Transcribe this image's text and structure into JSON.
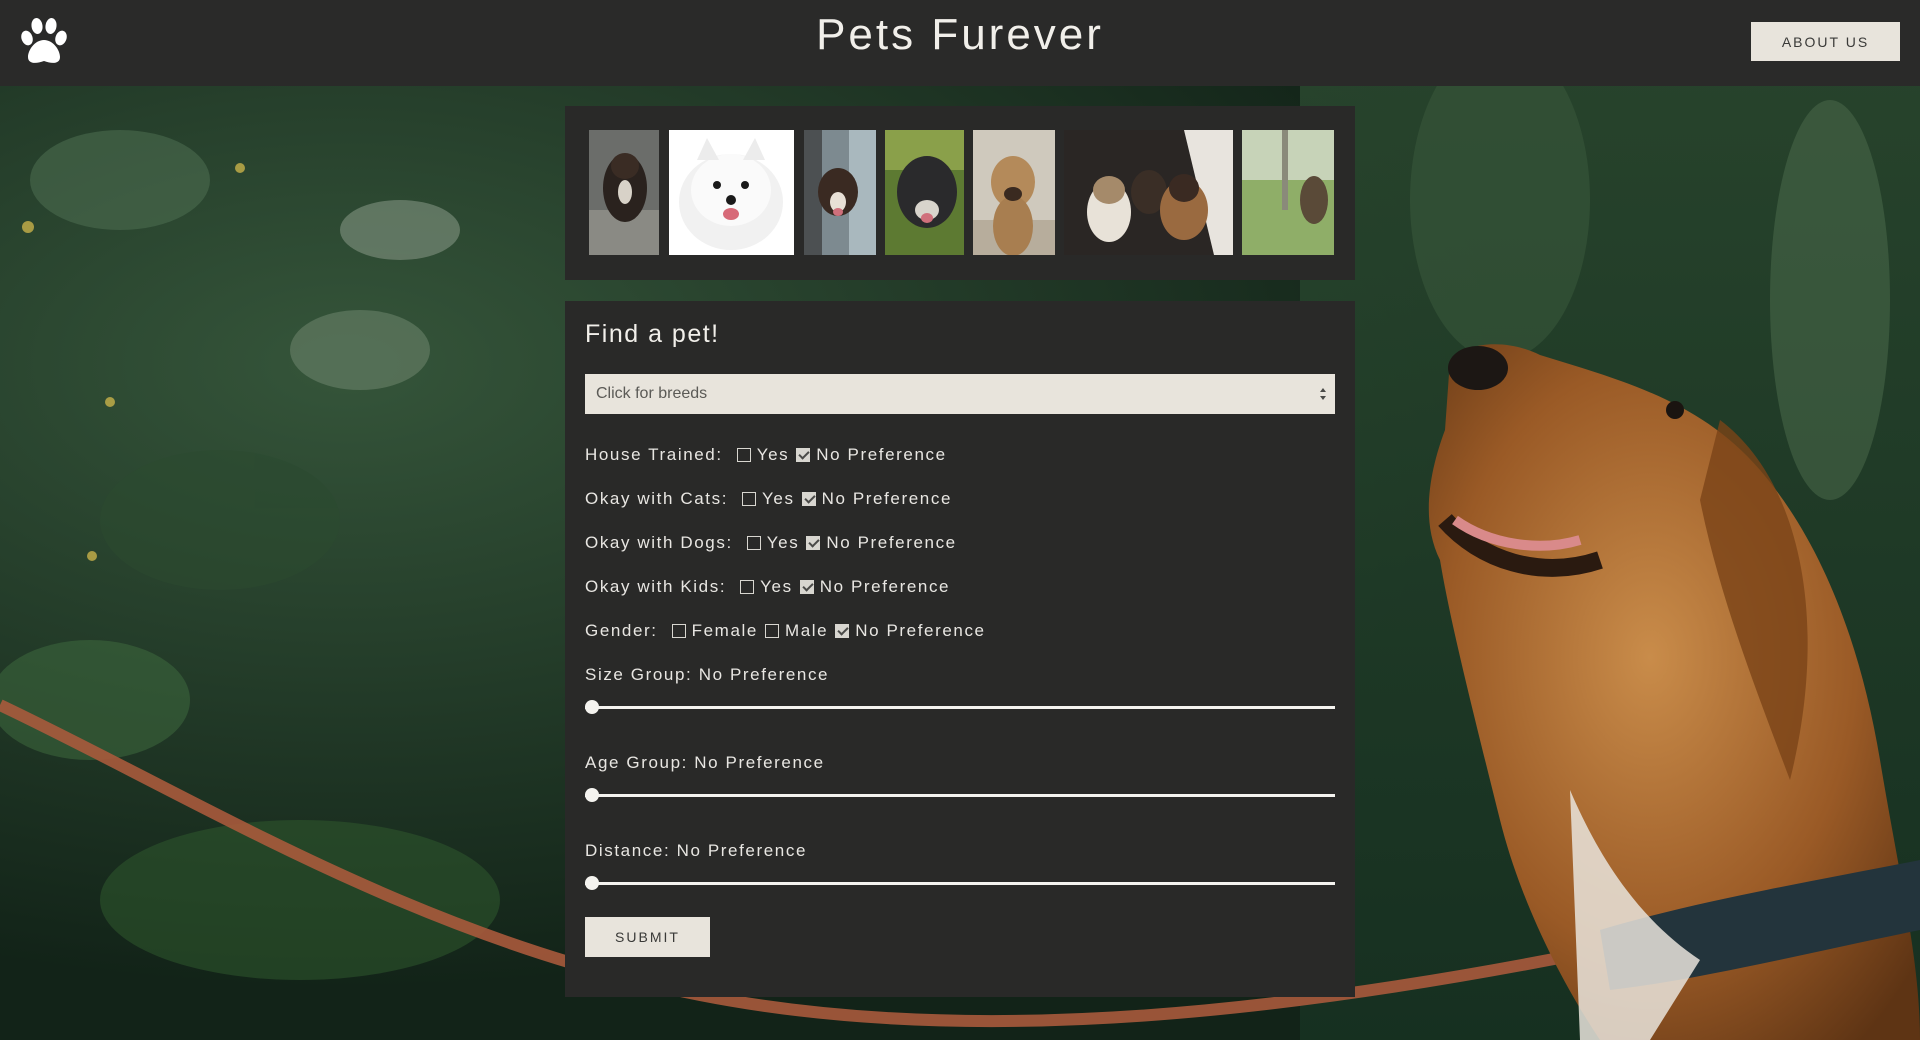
{
  "header": {
    "title": "Pets Furever",
    "about_label": "ABOUT US",
    "logo_icon": "paw-icon"
  },
  "gallery": {
    "photos": [
      {
        "name": "dog-photo-1"
      },
      {
        "name": "dog-photo-2"
      },
      {
        "name": "dog-photo-3"
      },
      {
        "name": "dog-photo-4"
      },
      {
        "name": "dog-photo-5"
      },
      {
        "name": "dog-photo-6"
      },
      {
        "name": "dog-photo-7"
      }
    ]
  },
  "form": {
    "title": "Find a pet!",
    "breed_placeholder": "Click for breeds",
    "house_trained": {
      "label": "House Trained:",
      "yes": "Yes",
      "no_pref": "No Preference",
      "yes_checked": false,
      "no_pref_checked": true
    },
    "ok_cats": {
      "label": "Okay with Cats:",
      "yes": "Yes",
      "no_pref": "No Preference",
      "yes_checked": false,
      "no_pref_checked": true
    },
    "ok_dogs": {
      "label": "Okay with Dogs:",
      "yes": "Yes",
      "no_pref": "No Preference",
      "yes_checked": false,
      "no_pref_checked": true
    },
    "ok_kids": {
      "label": "Okay with Kids:",
      "yes": "Yes",
      "no_pref": "No Preference",
      "yes_checked": false,
      "no_pref_checked": true
    },
    "gender": {
      "label": "Gender:",
      "female": "Female",
      "male": "Male",
      "no_pref": "No Preference",
      "female_checked": false,
      "male_checked": false,
      "no_pref_checked": true
    },
    "size": {
      "label": "Size Group: No Preference",
      "value": 0
    },
    "age": {
      "label": "Age Group: No Preference",
      "value": 0
    },
    "distance": {
      "label": "Distance: No Preference",
      "value": 0
    },
    "submit_label": "SUBMIT"
  },
  "colors": {
    "header_bg": "#2a2a29",
    "panel_bg": "#292928",
    "button_bg": "#e8e4dc",
    "text": "#e8e6e2"
  }
}
